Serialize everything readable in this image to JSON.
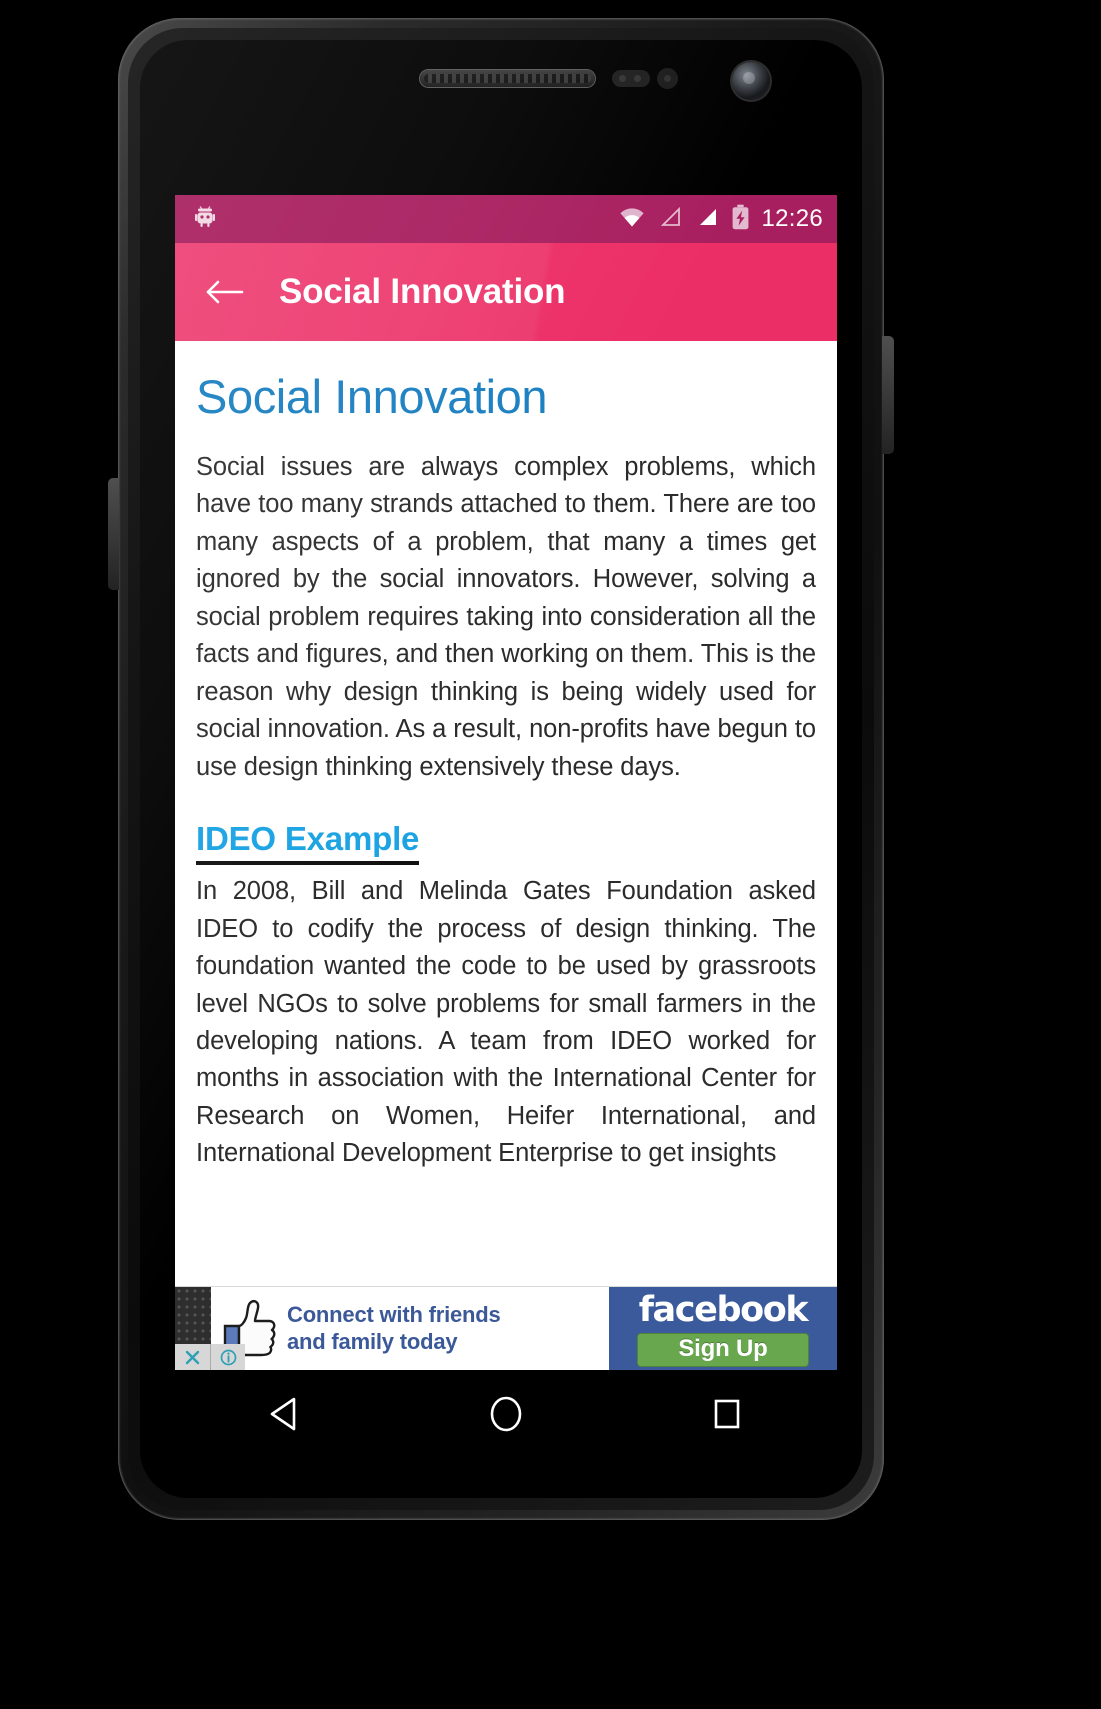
{
  "device": {
    "name": "android-phone-mockup",
    "hardware": {
      "earpiece": "earpiece-grille",
      "proximity_sensor": "proximity-sensor",
      "light_sensor": "light-sensor",
      "front_camera": "front-camera",
      "volume_button": "volume-rocker",
      "power_button": "power-button"
    }
  },
  "status_bar": {
    "time": "12:26",
    "background": "#a81f5f",
    "icons": [
      "android-robot-icon",
      "wifi-icon",
      "signal-empty-icon",
      "signal-full-icon",
      "battery-charging-icon"
    ]
  },
  "app_bar": {
    "background": "#ec2e66",
    "back_label": "back-arrow-icon",
    "title": "Social Innovation"
  },
  "content": {
    "heading": "Social Innovation",
    "heading_color": "#1a7fc1",
    "paragraph_1": "Social issues are always complex problems, which have too many strands attached to them. There are too many aspects of a problem, that many a times get ignored by the social innovators. However, solving a social problem requires taking into consideration all the facts and figures, and then working on them. This is the reason why design thinking is being widely used for social innovation. As a result, non-profits have begun to use design thinking extensively these days.",
    "subheading": "IDEO Example",
    "subheading_color": "#1ba3e3",
    "paragraph_2": "In 2008, Bill and Melinda Gates Foundation asked IDEO to codify the process of design thinking. The foundation wanted the code to be used by grassroots level NGOs to solve problems for small farmers in the developing nations. A team from IDEO worked for months in association with the International Center for Research on Women, Heifer International, and International Development Enterprise to get insights"
  },
  "ad": {
    "tagline_line_1": "Connect with friends",
    "tagline_line_2": "and family today",
    "brand": "facebook",
    "cta": "Sign Up",
    "brand_background": "#3a5a9b",
    "cta_background": "#69a74e",
    "thumb_icon": "thumbs-up-icon",
    "close_icon": "close-icon",
    "info_icon": "info-icon"
  },
  "nav_bar": {
    "background": "#000000",
    "buttons": [
      {
        "name": "back",
        "icon": "nav-back-triangle-icon"
      },
      {
        "name": "home",
        "icon": "nav-home-circle-icon"
      },
      {
        "name": "recents",
        "icon": "nav-recents-square-icon"
      }
    ]
  }
}
